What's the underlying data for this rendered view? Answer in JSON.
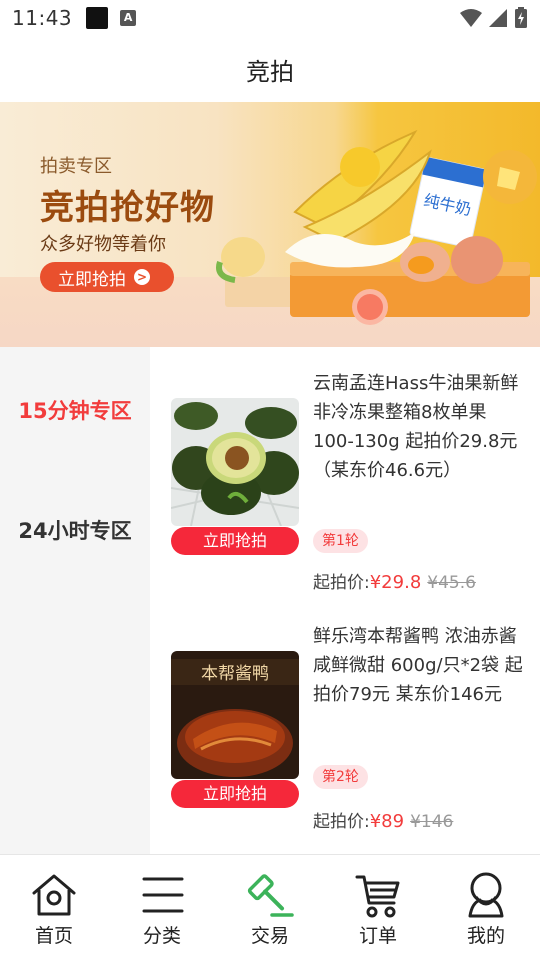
{
  "status_bar": {
    "time": "11:43"
  },
  "header": {
    "title": "竞拍"
  },
  "banner": {
    "subtitle": "拍卖专区",
    "title": "竞拍抢好物",
    "description": "众多好物等着你",
    "button_label": "立即抢拍",
    "button_arrow": ">",
    "milk_label": "纯牛奶"
  },
  "categories": [
    {
      "label": "15分钟专区",
      "active": true
    },
    {
      "label": "24小时专区",
      "active": false
    }
  ],
  "products": [
    {
      "name": "云南孟连Hass牛油果新鲜非冷冻果整箱8枚单果100-130g 起拍价29.8元（某东价46.6元）",
      "button_label": "立即抢拍",
      "round": "第1轮",
      "price_label": "起拍价:",
      "price_now": "¥29.8",
      "price_old": "¥45.6"
    },
    {
      "name": "鲜乐湾本帮酱鸭 浓油赤酱 咸鲜微甜 600g/只*2袋 起拍价79元 某东价146元",
      "button_label": "立即抢拍",
      "round": "第2轮",
      "price_label": "起拍价:",
      "price_now": "¥89",
      "price_old": "¥146",
      "package_text": "本帮酱鸭"
    }
  ],
  "bottom_nav": {
    "active_color": "#3cb35a",
    "items": [
      {
        "label": "首页",
        "icon": "home-icon"
      },
      {
        "label": "分类",
        "icon": "category-icon"
      },
      {
        "label": "交易",
        "icon": "auction-hammer-icon",
        "active": true
      },
      {
        "label": "订单",
        "icon": "cart-icon"
      },
      {
        "label": "我的",
        "icon": "user-icon"
      }
    ]
  }
}
